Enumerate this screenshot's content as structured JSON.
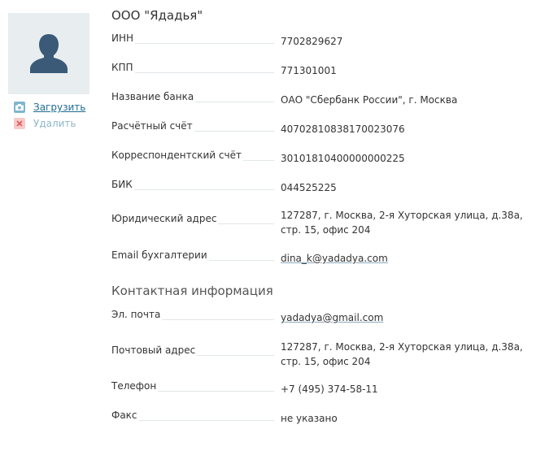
{
  "sidebar": {
    "upload_label": "Загрузить",
    "delete_label": "Удалить"
  },
  "company": {
    "name": "ООО \"Ядадья\"",
    "fields": {
      "inn": {
        "label": "ИНН",
        "value": "7702829627"
      },
      "kpp": {
        "label": "КПП",
        "value": "771301001"
      },
      "bank": {
        "label": "Название банка",
        "value": "ОАО \"Сбербанк России\", г. Москва"
      },
      "account": {
        "label": "Расчётный счёт",
        "value": "40702810838170023076"
      },
      "corr_account": {
        "label": "Корреспондентский счёт",
        "value": "30101810400000000225"
      },
      "bik": {
        "label": "БИК",
        "value": "044525225"
      },
      "legal_address": {
        "label": "Юридический адрес",
        "value": "127287, г. Москва, 2-я Хуторская улица, д.38а, стр. 15, офис 204"
      },
      "accounting_email": {
        "label": "Email бухгалтерии",
        "value": "dina_k@yadadya.com"
      }
    }
  },
  "contacts": {
    "title": "Контактная информация",
    "fields": {
      "email": {
        "label": "Эл. почта",
        "value": "yadadya@gmail.com"
      },
      "postal_address": {
        "label": "Почтовый адрес",
        "value": "127287, г. Москва, 2-я Хуторская улица, д.38а, стр. 15, офис 204"
      },
      "phone": {
        "label": "Телефон",
        "value": "+7 (495) 374-58-11"
      },
      "fax": {
        "label": "Факс",
        "value": "не указано"
      }
    }
  },
  "colors": {
    "avatar_bg": "#e8edf0",
    "avatar_figure": "#3b5a78",
    "link": "#1e6d93",
    "muted_link": "#8fb6c9"
  }
}
